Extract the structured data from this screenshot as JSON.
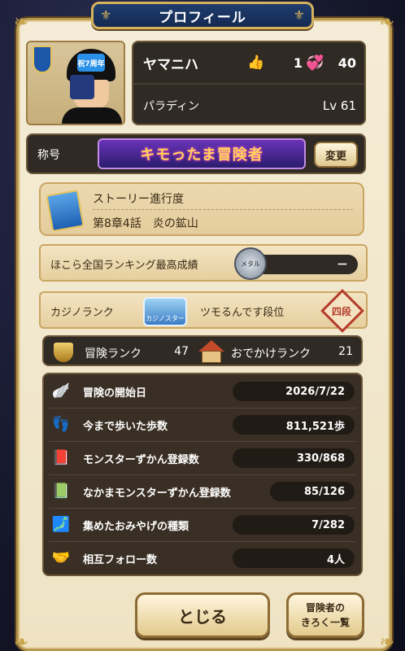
{
  "window": {
    "title": "プロフィール"
  },
  "player": {
    "name": "ヤマニハ",
    "likes": "1",
    "hearts": "40",
    "job": "パラディン",
    "level": "Lv 61",
    "avatar_badge": "祝7周年"
  },
  "title_section": {
    "label": "称号",
    "title_text": "キモったま冒険者",
    "change_label": "変更"
  },
  "story": {
    "heading": "ストーリー進行度",
    "chapter": "第8章4話　炎の鉱山"
  },
  "hokora": {
    "label": "ほこら全国ランキング最高成績",
    "medal_text": "メタル",
    "value": "－"
  },
  "casino": {
    "label": "カジノランク",
    "badge_text": "カジノスター",
    "rank_name": "ツモるんです段位",
    "dan": "四段"
  },
  "ranks": {
    "adventure_label": "冒険ランク",
    "adventure_value": "47",
    "outing_label": "おでかけランク",
    "outing_value": "21"
  },
  "stats": [
    {
      "icon": "wing-icon",
      "label": "冒険の開始日",
      "value": "2026/7/22"
    },
    {
      "icon": "footprints-icon",
      "label": "今まで歩いた歩数",
      "value": "811,521歩"
    },
    {
      "icon": "monster-book-icon",
      "label": "モンスターずかん登録数",
      "value": "330/868"
    },
    {
      "icon": "ally-book-icon",
      "label": "なかまモンスターずかん登録数",
      "value": "85/126"
    },
    {
      "icon": "japan-map-icon",
      "label": "集めたおみやげの種類",
      "value": "7/282"
    },
    {
      "icon": "handshake-icon",
      "label": "相互フォロー数",
      "value": "4人"
    }
  ],
  "buttons": {
    "close": "とじる",
    "records_line1": "冒険者の",
    "records_line2": "きろく一覧"
  },
  "colors": {
    "panel_bg": "#f4ecd6",
    "dark_box": "#2f2a24",
    "gold_border": "#b8974f",
    "title_bar": "#1f3d6e"
  }
}
